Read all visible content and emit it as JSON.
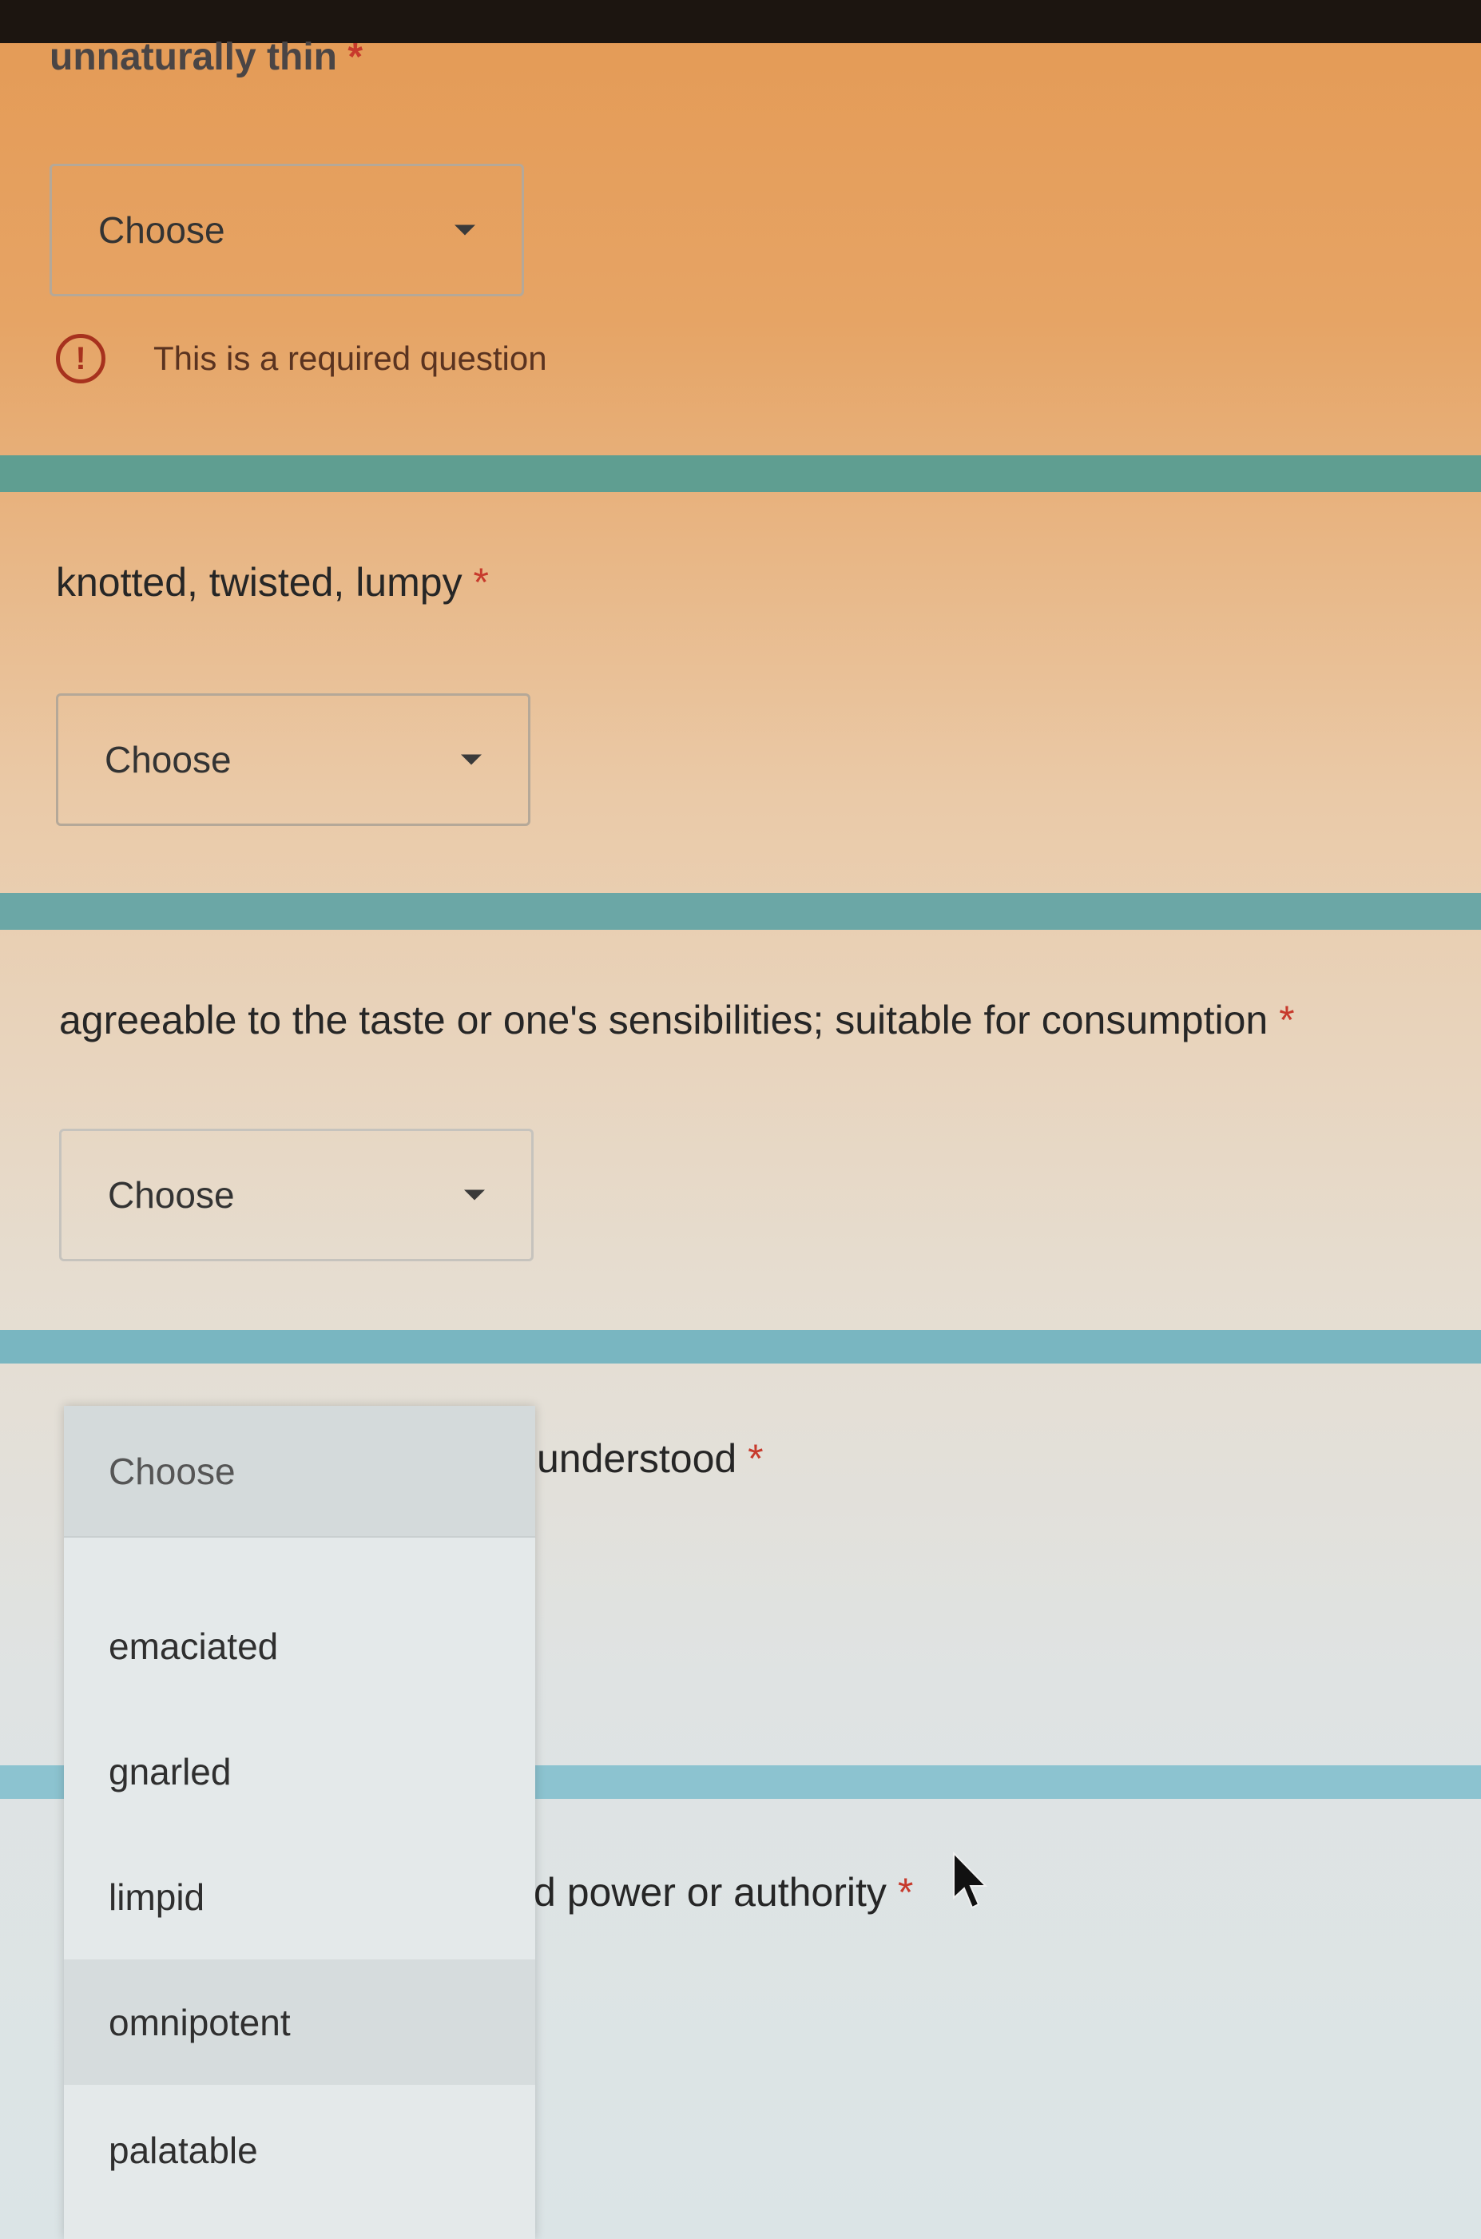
{
  "questions": [
    {
      "title": "unnaturally thin",
      "required_mark": "*",
      "select_label": "Choose",
      "error": "This is a required question"
    },
    {
      "title": "knotted, twisted, lumpy",
      "required_mark": "*",
      "select_label": "Choose"
    },
    {
      "title": "agreeable to the taste or one's sensibilities; suitable for consumption",
      "required_mark": "*",
      "select_label": "Choose"
    },
    {
      "title_visible": "understood",
      "required_mark": "*"
    },
    {
      "title_visible": "d power or authority",
      "required_mark": "*"
    }
  ],
  "dropdown": {
    "selected": "Choose",
    "options": [
      "emaciated",
      "gnarled",
      "limpid",
      "omnipotent",
      "palatable"
    ],
    "highlighted_option": "omnipotent"
  },
  "icons": {
    "error": "exclamation-circle-icon",
    "caret": "caret-down-icon",
    "cursor": "mouse-pointer-icon"
  },
  "colors": {
    "accent_divider": "#5f9e91",
    "error": "#a7321e",
    "required_star": "#c73a2c"
  }
}
